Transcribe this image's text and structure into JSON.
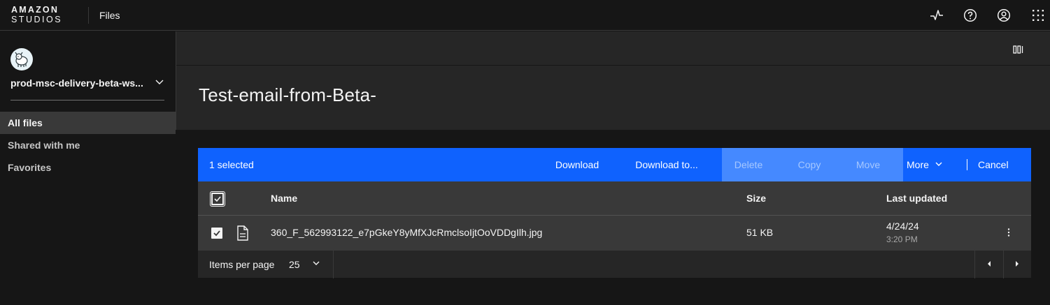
{
  "brand": {
    "line1": "AMAZON",
    "line2": "STUDIOS"
  },
  "app_name": "Files",
  "topbar_icons": [
    "activity-icon",
    "help-icon",
    "user-profile-icon",
    "app-switcher-icon"
  ],
  "sidebar": {
    "workspace_name": "prod-msc-delivery-beta-ws...",
    "items": [
      {
        "label": "All files",
        "active": true
      },
      {
        "label": "Shared with me",
        "active": false
      },
      {
        "label": "Favorites",
        "active": false
      }
    ]
  },
  "page": {
    "title": "Test-email-from-Beta-"
  },
  "action_bar": {
    "selected_text": "1 selected",
    "download": "Download",
    "download_to": "Download to...",
    "delete": "Delete",
    "copy": "Copy",
    "move": "Move",
    "more": "More",
    "cancel": "Cancel",
    "bg_color": "#0f62fe"
  },
  "table": {
    "headers": {
      "name": "Name",
      "size": "Size",
      "updated": "Last updated"
    },
    "rows": [
      {
        "name": "360_F_562993122_e7pGkeY8yMfXJcRmclsoIjtOoVDDgIlh.jpg",
        "size": "51 KB",
        "date": "4/24/24",
        "time": "3:20 PM",
        "checked": true,
        "icon": "document-icon"
      }
    ]
  },
  "pagination": {
    "items_per_page_label": "Items per page",
    "items_per_page_value": "25"
  }
}
